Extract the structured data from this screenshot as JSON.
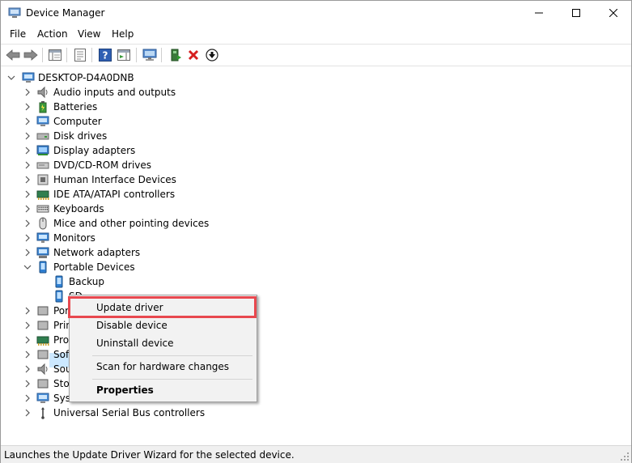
{
  "window": {
    "title": "Device Manager"
  },
  "menu": [
    "File",
    "Action",
    "View",
    "Help"
  ],
  "toolbar": {
    "icons": [
      "back-arrow-icon",
      "forward-arrow-icon",
      "show-hide-console-tree-icon",
      "properties-icon",
      "help-icon",
      "action-pane-icon",
      "scan-hardware-icon",
      "update-driver-icon",
      "uninstall-device-icon",
      "enable-device-icon"
    ]
  },
  "tree": {
    "root": "DESKTOP-D4A0DNB",
    "categories": [
      {
        "label": "Audio inputs and outputs",
        "icon": "speaker-icon",
        "expanded": false
      },
      {
        "label": "Batteries",
        "icon": "battery-icon",
        "expanded": false
      },
      {
        "label": "Computer",
        "icon": "computer-icon",
        "expanded": false
      },
      {
        "label": "Disk drives",
        "icon": "disk-drive-icon",
        "expanded": false
      },
      {
        "label": "Display adapters",
        "icon": "display-adapter-icon",
        "expanded": false
      },
      {
        "label": "DVD/CD-ROM drives",
        "icon": "dvd-drive-icon",
        "expanded": false
      },
      {
        "label": "Human Interface Devices",
        "icon": "hid-icon",
        "expanded": false
      },
      {
        "label": "IDE ATA/ATAPI controllers",
        "icon": "ide-controller-icon",
        "expanded": false
      },
      {
        "label": "Keyboards",
        "icon": "keyboard-icon",
        "expanded": false
      },
      {
        "label": "Mice and other pointing devices",
        "icon": "mouse-icon",
        "expanded": false
      },
      {
        "label": "Monitors",
        "icon": "monitor-icon",
        "expanded": false
      },
      {
        "label": "Network adapters",
        "icon": "network-adapter-icon",
        "expanded": false
      },
      {
        "label": "Portable Devices",
        "icon": "portable-device-icon",
        "expanded": true
      }
    ],
    "portable_children": [
      "Backup",
      "SD"
    ],
    "partial_categories": [
      "Por",
      "Prin",
      "Pro",
      "Sof",
      "Sou",
      "Sto",
      "Syst"
    ],
    "last_category": "Universal Serial Bus controllers"
  },
  "context_menu": {
    "items": [
      "Update driver",
      "Disable device",
      "Uninstall device",
      "Scan for hardware changes",
      "Properties"
    ]
  },
  "status": {
    "text": "Launches the Update Driver Wizard for the selected device."
  },
  "colors": {
    "selection": "#cce8ff",
    "highlight_border": "#e8484f",
    "menu_bg": "#f2f2f2"
  }
}
